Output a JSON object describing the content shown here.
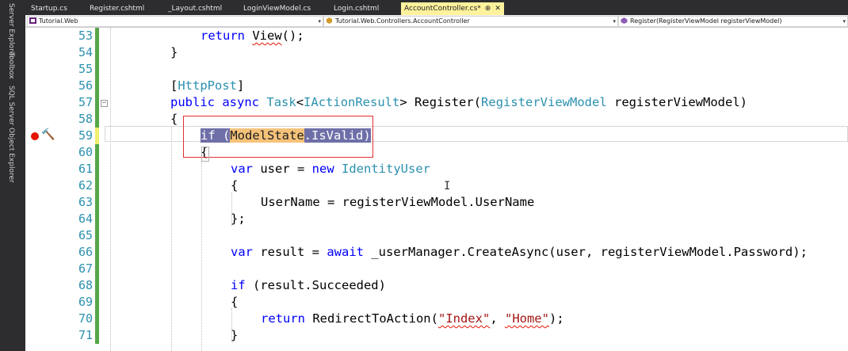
{
  "side_panels": [
    "Server Explorer",
    "Toolbox",
    "SQL Server Object Explorer"
  ],
  "tabs": [
    {
      "label": "Startup.cs",
      "active": false
    },
    {
      "label": "Register.cshtml",
      "active": false
    },
    {
      "label": "_Layout.cshtml",
      "active": false
    },
    {
      "label": "LoginViewModel.cs",
      "active": false
    },
    {
      "label": "Login.cshtml",
      "active": false
    },
    {
      "label": "AccountController.cs*",
      "active": true
    }
  ],
  "navbar": {
    "project": "Tutorial.Web",
    "class": "Tutorial.Web.Controllers.AccountController",
    "member": "Register(RegisterViewModel registerViewModel)"
  },
  "lines": [
    {
      "num": "53",
      "text": "return View();"
    },
    {
      "num": "54",
      "text": "}"
    },
    {
      "num": "55",
      "text": ""
    },
    {
      "num": "56",
      "text": "[HttpPost]"
    },
    {
      "num": "57",
      "text": "public async Task<IActionResult> Register(RegisterViewModel registerViewModel)"
    },
    {
      "num": "58",
      "text": "{"
    },
    {
      "num": "59",
      "text": "if (ModelState.IsValid)"
    },
    {
      "num": "60",
      "text": "{"
    },
    {
      "num": "61",
      "text": "var user = new IdentityUser"
    },
    {
      "num": "62",
      "text": "{"
    },
    {
      "num": "63",
      "text": "UserName = registerViewModel.UserName"
    },
    {
      "num": "64",
      "text": "};"
    },
    {
      "num": "65",
      "text": ""
    },
    {
      "num": "66",
      "text": "var result = await _userManager.CreateAsync(user, registerViewModel.Password);"
    },
    {
      "num": "67",
      "text": ""
    },
    {
      "num": "68",
      "text": "if (result.Succeeded)"
    },
    {
      "num": "69",
      "text": "{"
    },
    {
      "num": "70",
      "text": "return RedirectToAction(\"Index\", \"Home\");"
    },
    {
      "num": "71",
      "text": "}"
    }
  ],
  "tokens": {
    "kw_return": "return",
    "kw_public": "public",
    "kw_async": "async",
    "kw_if": "if",
    "kw_var": "var",
    "kw_new": "new",
    "kw_await": "await",
    "id_View": "View",
    "id_HttpPost": "HttpPost",
    "id_Task": "Task",
    "id_IActionResult": "IActionResult",
    "id_Register": "Register",
    "id_RegisterViewModel": "RegisterViewModel",
    "id_registerViewModel": "registerViewModel",
    "id_ModelState": "ModelState",
    "id_IsValid": ".IsValid",
    "id_IdentityUser": "IdentityUser",
    "str_Index": "\"Index\"",
    "str_Home": "\"Home\""
  },
  "icons": {
    "breakpoint": "breakpoint-icon",
    "quick_action": "hammer-icon",
    "collapse": "collapse-minus-icon"
  },
  "colors": {
    "keyword": "#0000ff",
    "type": "#2b91af",
    "string": "#a31515",
    "line_number": "#2b91af",
    "selection": "#6f6fa8",
    "change_bar_saved": "#57a64a",
    "change_bar_unsaved": "#efef6c",
    "breakpoint": "#e51400"
  }
}
